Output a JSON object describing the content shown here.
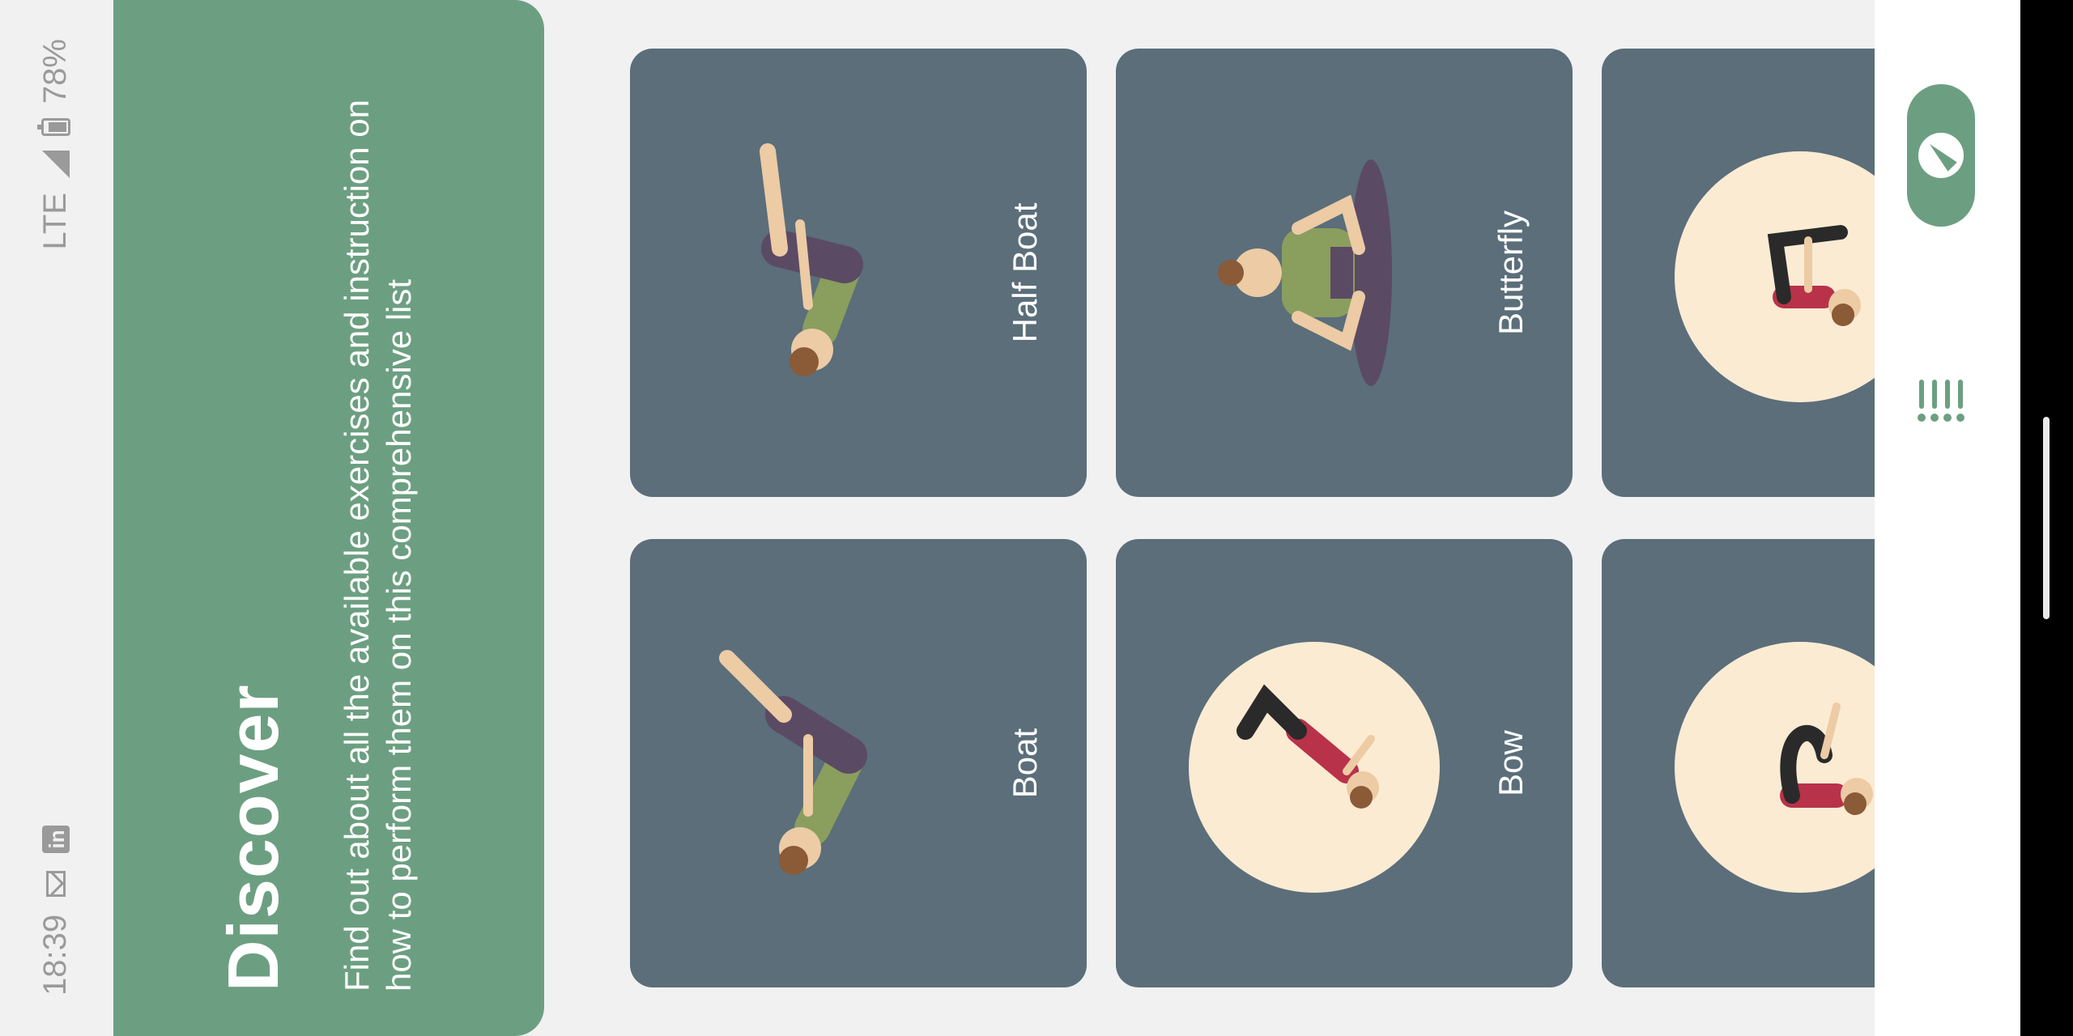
{
  "status_bar": {
    "time": "18:39",
    "network": "LTE",
    "battery": "78%",
    "icons": [
      "mail-icon",
      "linkedin-icon",
      "signal-icon",
      "battery-icon"
    ]
  },
  "header": {
    "title": "Discover",
    "description": "Find out about all the available exercises and instruction on how to perform them on this comprehensive list"
  },
  "exercises": [
    {
      "label": "Boat",
      "icon": "boat-pose-illustration"
    },
    {
      "label": "Half Boat",
      "icon": "half-boat-pose-illustration"
    },
    {
      "label": "Bow",
      "icon": "bow-pose-illustration"
    },
    {
      "label": "Butterfly",
      "icon": "butterfly-pose-illustration"
    },
    {
      "label": "",
      "icon": "pose-illustration"
    },
    {
      "label": "",
      "icon": "pose-illustration"
    }
  ],
  "bottom_nav": {
    "items": [
      {
        "name": "list",
        "icon": "list-icon",
        "active": false
      },
      {
        "name": "discover",
        "icon": "compass-icon",
        "active": true
      }
    ]
  },
  "colors": {
    "accent": "#6c9f81",
    "card": "#5b6e7a",
    "disc": "#fbebd3",
    "background": "#f1f1f1"
  }
}
